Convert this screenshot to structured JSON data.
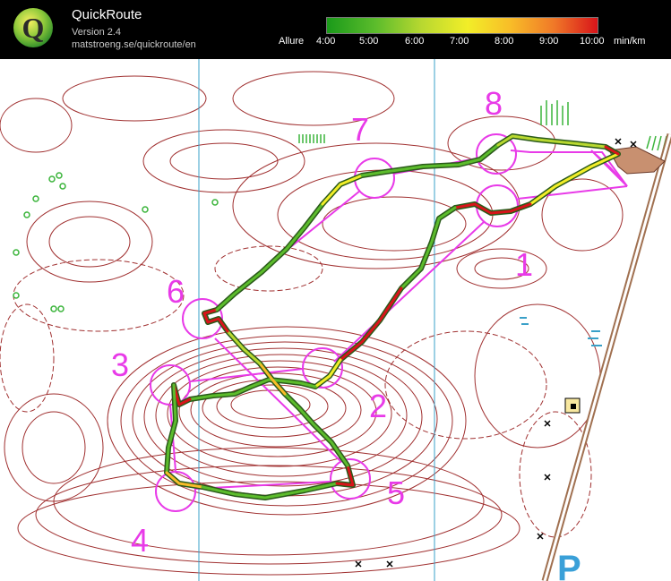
{
  "app": {
    "title": "QuickRoute",
    "version": "Version 2.4",
    "url": "matstroeng.se/quickroute/en",
    "logo_letter": "Q"
  },
  "pace_scale": {
    "caption": "Allure",
    "ticks": [
      "4:00",
      "5:00",
      "6:00",
      "7:00",
      "8:00",
      "9:00",
      "10:00"
    ],
    "unit": "min/km",
    "colors": {
      "fast": "#1a9a1a",
      "mid": "#f2ee28",
      "slow": "#d8141a"
    }
  },
  "map": {
    "colors": {
      "contours": "#a03030",
      "course": "#e83ae8",
      "magnetic_north_lines": "#3aa0c8",
      "road": "#a07050"
    },
    "controls": [
      {
        "label": "1"
      },
      {
        "label": "2"
      },
      {
        "label": "3"
      },
      {
        "label": "4"
      },
      {
        "label": "5"
      },
      {
        "label": "6"
      },
      {
        "label": "7"
      },
      {
        "label": "8"
      }
    ],
    "symbols": {
      "parking_label": "P"
    }
  }
}
